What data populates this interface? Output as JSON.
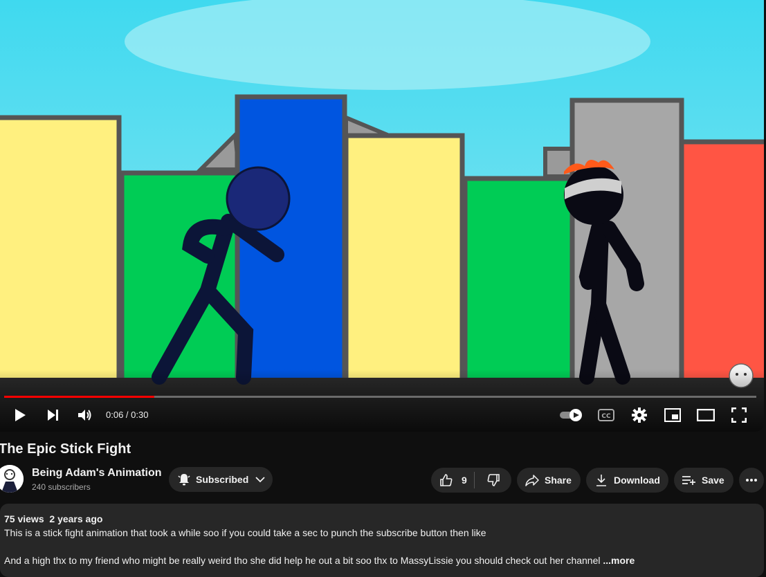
{
  "player": {
    "time_current": "0:06",
    "time_separator": " / ",
    "time_total": "0:30",
    "progress_fraction": 0.2
  },
  "video": {
    "title": "The Epic Stick Fight"
  },
  "channel": {
    "name": "Being Adam's Animation",
    "subscribers": "240 subscribers",
    "subscribed_label": "Subscribed"
  },
  "actions": {
    "likes": "9",
    "share_label": "Share",
    "download_label": "Download",
    "save_label": "Save"
  },
  "description": {
    "views": "75 views",
    "age": "2 years ago",
    "line1": "This is a stick fight animation that took a while soo if you could take a sec to punch the subscribe button then like",
    "line2": "And a high thx to my friend who might be really weird tho she did help he out a bit  soo thx to MassyLissie you should check out her channel",
    "more_label": "...more"
  },
  "colors": {
    "progress_played": "#ff0000",
    "background": "#0f0f0f",
    "pill": "#272727"
  }
}
